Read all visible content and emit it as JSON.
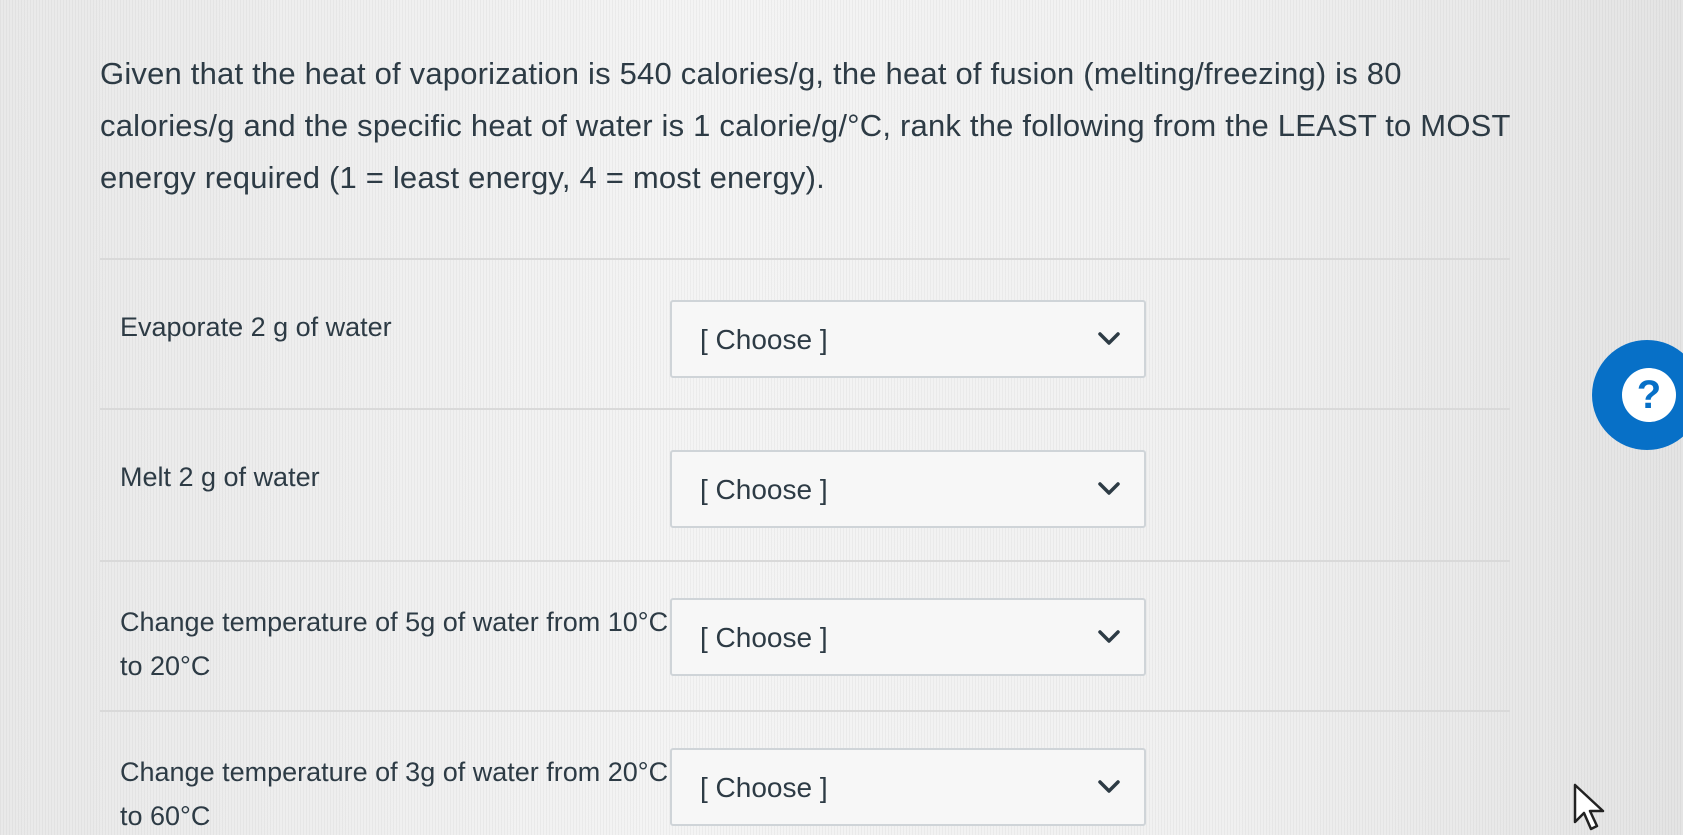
{
  "question": {
    "text": "Given that the heat of vaporization is 540 calories/g, the heat of fusion (melting/freezing) is 80 calories/g and the specific heat of water is 1 calorie/g/°C, rank the following from the LEAST to MOST energy required (1 = least energy, 4 = most energy)."
  },
  "rows": [
    {
      "label": "Evaporate 2 g of water",
      "selected": "[ Choose ]"
    },
    {
      "label": "Melt 2 g of water",
      "selected": "[ Choose ]"
    },
    {
      "label": "Change temperature of 5g of water from 10°C to 20°C",
      "selected": "[ Choose ]"
    },
    {
      "label": "Change temperature of 3g of water from 20°C to 60°C",
      "selected": "[ Choose ]"
    }
  ],
  "help": {
    "symbol": "?"
  },
  "colors": {
    "text": "#2d3b45",
    "help_blue": "#0770c7",
    "divider": "#d9d9d9",
    "select_border": "#cfd4d8"
  },
  "icons": {
    "dropdown": "chevron-down-icon",
    "help": "question-mark-icon",
    "cursor": "mouse-pointer-icon"
  }
}
